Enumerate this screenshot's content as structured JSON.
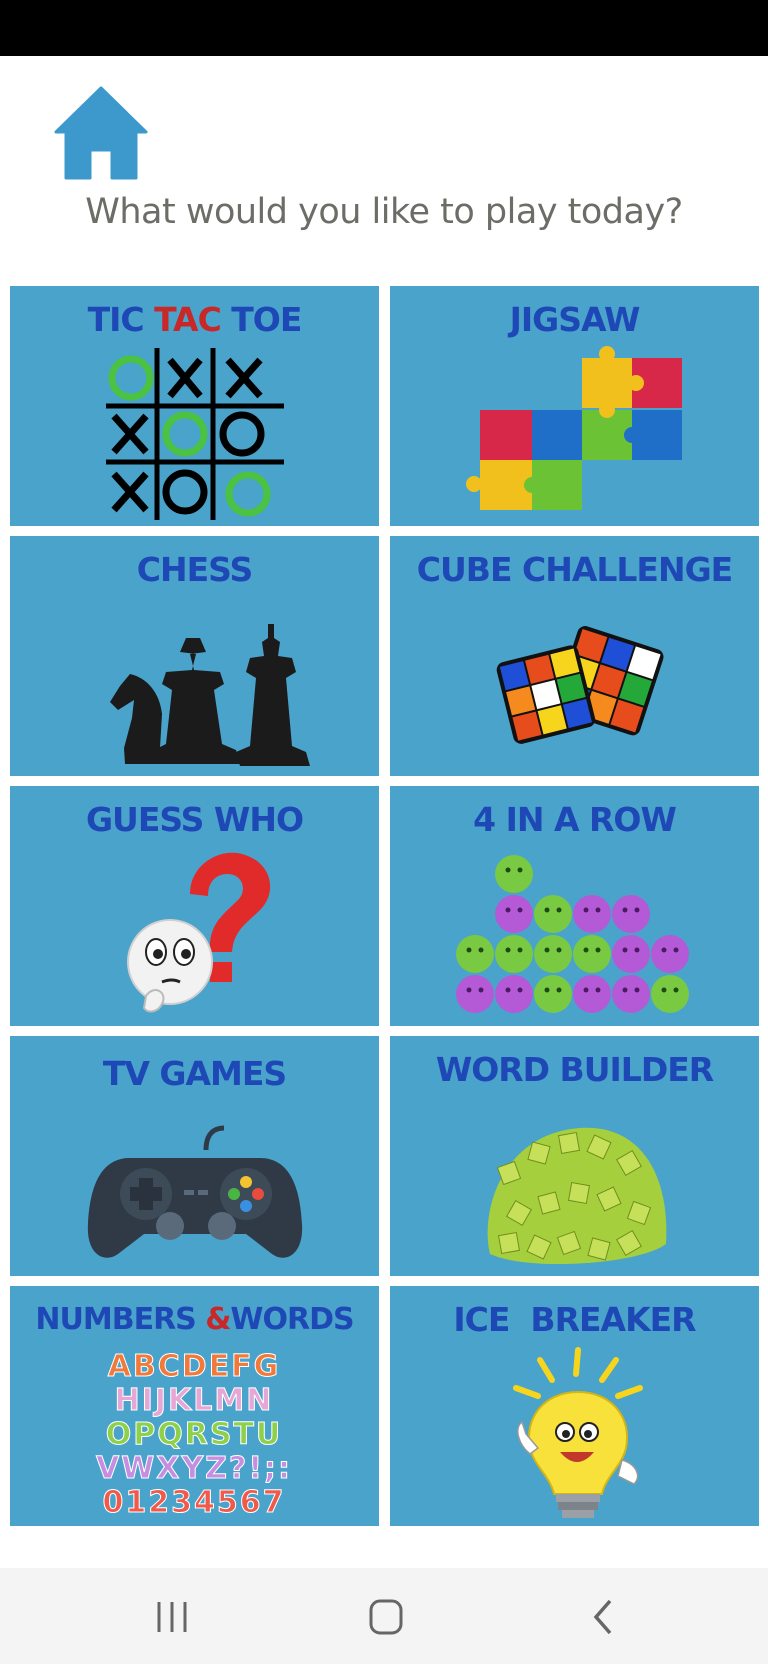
{
  "header": {
    "prompt": "What would you like to play today?",
    "home_icon": "home-icon"
  },
  "tiles": [
    {
      "label_a": "TIC ",
      "label_b": "TAC",
      "label_c": " TOE",
      "icon": "tic-tac-toe-grid"
    },
    {
      "label": "JIGSAW",
      "icon": "jigsaw-puzzle-pieces"
    },
    {
      "label": "CHESS",
      "icon": "chess-pieces"
    },
    {
      "label": "CUBE CHALLENGE",
      "icon": "rubiks-cubes"
    },
    {
      "label": "GUESS WHO",
      "icon": "thinking-face-question-mark"
    },
    {
      "label": "4 IN A ROW",
      "icon": "smiley-balls"
    },
    {
      "label": "TV GAMES",
      "icon": "game-controller"
    },
    {
      "label": "WORD BUILDER",
      "icon": "letter-tiles"
    },
    {
      "label_a": "NUMBERS ",
      "label_b": "&",
      "label_c": "WORDS",
      "icon": "alphabet-letters"
    },
    {
      "label": "ICE  BREAKER",
      "icon": "light-bulb"
    }
  ],
  "alphabet": {
    "row1": "ABCDEFG",
    "row2": "HIJKLMN",
    "row3": "OPQRSTU",
    "row4": "VWXYZ?!;:",
    "row5": "01234567"
  },
  "nav": {
    "recent": "recent-apps-icon",
    "home": "home-circle-icon",
    "back": "back-chevron-icon"
  },
  "colors": {
    "tile_bg": "#4aa3cb",
    "title_blue": "#1d48b5",
    "title_red": "#c82828",
    "home_blue": "#3d98cc"
  }
}
